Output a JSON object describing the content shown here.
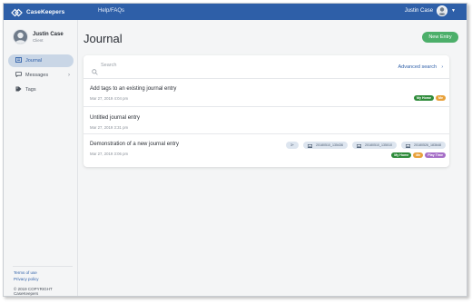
{
  "app": {
    "name": "CaseKeepers"
  },
  "topbar": {
    "help_label": "Help/FAQs",
    "user_name": "Justin Case"
  },
  "sidebar": {
    "profile": {
      "name": "Justin Case",
      "role": "Client"
    },
    "items": [
      {
        "label": "Journal",
        "icon": "book-icon"
      },
      {
        "label": "Messages",
        "icon": "chat-icon"
      },
      {
        "label": "Tags",
        "icon": "tag-icon"
      }
    ],
    "footer": {
      "terms": "Terms of use",
      "privacy": "Privacy policy",
      "copyright": "© 2019 COPYRIGHT CaseKeepers"
    }
  },
  "main": {
    "title": "Journal",
    "new_entry_label": "New Entry",
    "search": {
      "placeholder": "Search",
      "advanced_label": "Advanced search"
    },
    "entries": [
      {
        "title": "Add tags to an existing journal entry",
        "date": "Mar 27, 2019 4:04 pm",
        "tags": [
          {
            "label": "My Home",
            "color": "#2e8b3a"
          },
          {
            "label": "Me",
            "color": "#e8a13a"
          }
        ]
      },
      {
        "title": "Untitled journal entry",
        "date": "Mar 27, 2019 3:31 pm",
        "tags": []
      },
      {
        "title": "Demonstration of a new journal entry",
        "date": "Mar 27, 2019 3:06 pm",
        "attachments": [
          {
            "label": "3+"
          },
          {
            "label": "20180510_135436"
          },
          {
            "label": "20180510_135010"
          },
          {
            "label": "20180526_183648"
          }
        ],
        "tags": [
          {
            "label": "My Home",
            "color": "#2e8b3a"
          },
          {
            "label": "Me",
            "color": "#e8a13a"
          },
          {
            "label": "Play Time",
            "color": "#a66fc7"
          }
        ]
      }
    ]
  },
  "colors": {
    "topbar": "#2e5fa8",
    "accent": "#2e5fa8",
    "new_entry": "#4caf6a"
  }
}
